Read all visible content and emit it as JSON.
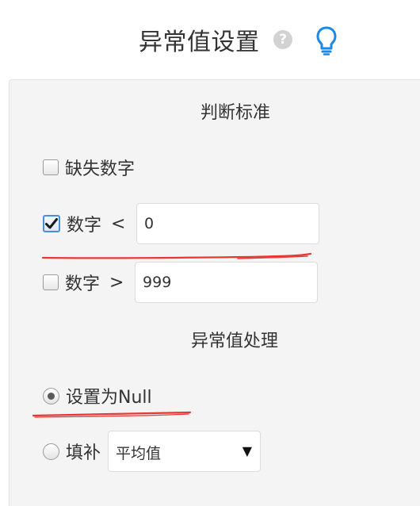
{
  "header": {
    "title": "异常值设置",
    "help_glyph": "?",
    "help_icon": "question-circle-icon",
    "bulb_icon": "lightbulb-icon",
    "accent_color": "#1e88e5"
  },
  "criteria": {
    "title": "判断标准",
    "missing_label": "缺失数字",
    "missing_checked": false,
    "less_than": {
      "label": "数字",
      "operator": "<",
      "value": "0",
      "checked": true
    },
    "greater_than": {
      "label": "数字",
      "operator": ">",
      "value": "999",
      "checked": false
    }
  },
  "handling": {
    "title": "异常值处理",
    "set_null_label": "设置为Null",
    "set_null_selected": true,
    "fill_label": "填补",
    "fill_selected": false,
    "fill_option": "平均值",
    "dropdown_arrow": "▼"
  },
  "annotations": {
    "underline_color": "#e53935"
  }
}
